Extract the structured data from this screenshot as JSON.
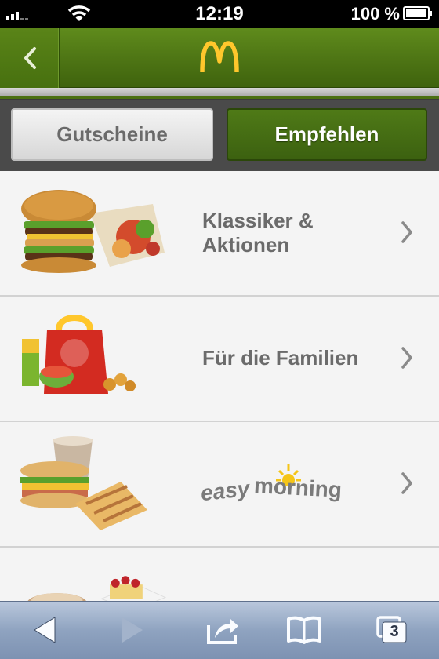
{
  "status_bar": {
    "time": "12:19",
    "battery": "100 %"
  },
  "header": {
    "logo_letter": "M"
  },
  "segments": [
    {
      "label": "Gutscheine",
      "selected": false
    },
    {
      "label": "Empfehlen",
      "selected": true
    }
  ],
  "list": {
    "items": [
      {
        "label_line1": "Klassiker &",
        "label_line2": "Aktionen"
      },
      {
        "label_line1": "Für die Familien"
      },
      {
        "logo_text_a": "easy",
        "logo_text_b": "morning"
      }
    ]
  },
  "toolbar": {
    "tabs_count": "3"
  },
  "colors": {
    "brand_green": "#4d7414",
    "brand_gold": "#ffc72c",
    "label_gray": "#6b6b6b"
  }
}
